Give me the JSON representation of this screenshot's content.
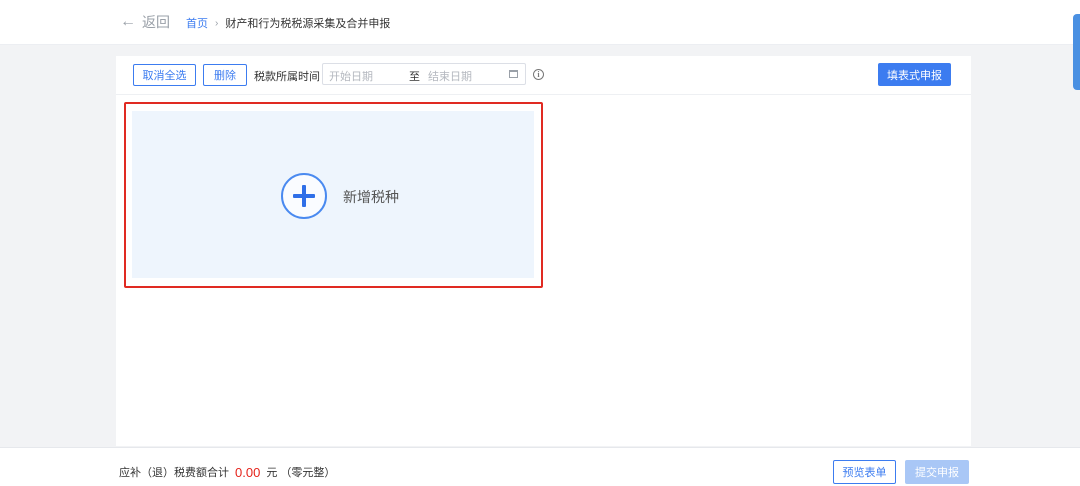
{
  "header": {
    "back_label": "返回",
    "breadcrumb_home": "首页",
    "breadcrumb_separator": "›",
    "breadcrumb_current": "财产和行为税税源采集及合并申报"
  },
  "toolbar": {
    "cancel_select_all": "取消全选",
    "delete": "删除",
    "period_label": "税款所属时间",
    "date_start_placeholder": "开始日期",
    "date_separator": "至",
    "date_end_placeholder": "结束日期",
    "fill_form_declare": "填表式申报"
  },
  "add_card": {
    "label": "新增税种"
  },
  "footer": {
    "total_prefix": "应补（退）税费额合计",
    "total_amount": "0.00",
    "total_suffix": "元 （零元整）",
    "preview_button": "预览表单",
    "submit_button": "提交申报"
  },
  "colors": {
    "accent": "#3c7cf0",
    "highlight_border": "#e02a22",
    "amount": "#e5231b",
    "disabled_button": "#a9c7f6"
  }
}
